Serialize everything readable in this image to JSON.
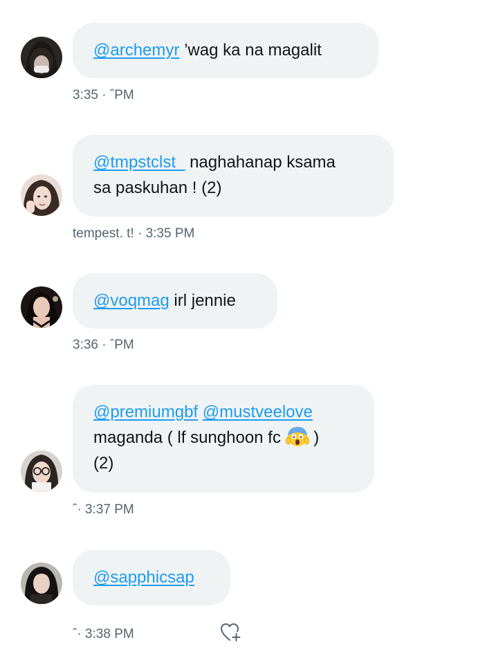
{
  "messages": [
    {
      "mentions": [
        "@archemyr"
      ],
      "text": "’wag ka na magalit",
      "meta": "3:35 · ˆPM"
    },
    {
      "mentions": [
        "@tmpstclst_"
      ],
      "text_line1": "naghahanap ksama",
      "text_line2": "sa paskuhan ! (2)",
      "meta": "tempest. t! · 3:35 PM"
    },
    {
      "mentions": [
        "@voqmag"
      ],
      "text": "irl jennie",
      "meta": "3:36 · ˆPM"
    },
    {
      "mentions": [
        "@premiumgbf",
        "@mustveelove"
      ],
      "text_line2_pre": "maganda ( lf sunghoon fc",
      "text_line2_post": ")",
      "text_line3": "(2)",
      "emoji": "screaming-face-emoji",
      "meta": "ˆ· 3:37 PM"
    },
    {
      "mentions": [
        "@sapphicsap"
      ],
      "meta": "ˆ· 3:38 PM",
      "reaction_icon": "add-reaction-heart-icon"
    }
  ],
  "colors": {
    "bubble_bg": "#eff3f4",
    "mention": "#1d9bf0",
    "text": "#0f1419",
    "meta": "#536471"
  }
}
